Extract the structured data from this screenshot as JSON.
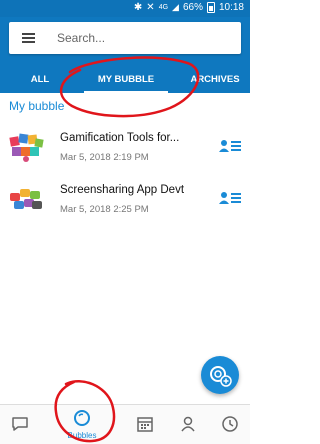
{
  "status_bar": {
    "battery": "66%",
    "time": "10:18",
    "network": "4G"
  },
  "search": {
    "placeholder": "Search..."
  },
  "tabs": [
    {
      "label": "ALL",
      "active": false
    },
    {
      "label": "MY BUBBLE",
      "active": true
    },
    {
      "label": "ARCHIVES",
      "active": false
    }
  ],
  "section": {
    "title": "My bubble"
  },
  "bubbles": [
    {
      "title": "Gamification Tools for...",
      "date": "Mar 5, 2018 2:19 PM",
      "icon": "gamification-thumbnail-icon"
    },
    {
      "title": "Screensharing App Devt",
      "date": "Mar 5, 2018 2:25 PM",
      "icon": "screensharing-thumbnail-icon"
    }
  ],
  "bottom_nav": [
    {
      "icon": "chat-icon",
      "label": ""
    },
    {
      "icon": "bubbles-icon",
      "label": "Bubbles",
      "active": true
    },
    {
      "icon": "calendar-icon",
      "label": ""
    },
    {
      "icon": "contacts-icon",
      "label": ""
    },
    {
      "icon": "clock-icon",
      "label": ""
    }
  ],
  "colors": {
    "primary": "#0f78bf",
    "accent": "#1a8bd6",
    "annotation": "#e0151b"
  }
}
